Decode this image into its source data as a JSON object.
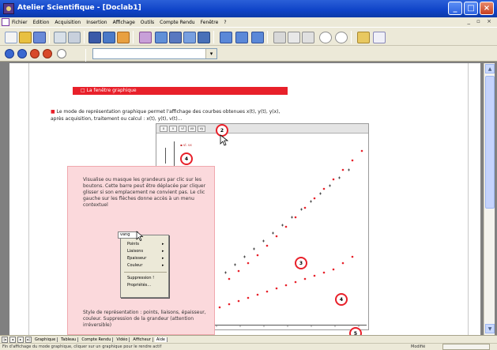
{
  "window": {
    "title": "Atelier Scientifique - [Doclab1]",
    "minimize": "_",
    "maximize": "□",
    "close": "×"
  },
  "menu": {
    "items": [
      "Fichier",
      "Edition",
      "Acquisition",
      "Insertion",
      "Affichage",
      "Outils",
      "Compte Rendu",
      "Fenêtre",
      "?"
    ],
    "mdi_controls": "_ ▫ ×"
  },
  "toolbar2": {
    "combo_value": "",
    "combo_arrow": "▾"
  },
  "document": {
    "section_title": "□ La fenêtre graphique",
    "intro_bullet": "■",
    "intro_line1": "Le mode de représentation graphique permet l'affichage des courbes obtenues x(t), y(t), y(x),",
    "intro_line2": "après acquisition, traitement ou calcul : x(t), y(t), v(t)...",
    "help_paragraph": "Visualise ou masque les grandeurs par clic sur les boutons. Cette barre peut être déplacée par cliquer glisser si son emplacement ne convient pas. Le clic gauche sur les flèches donne accès à un menu contextuel",
    "help_paragraph2": "Style de représentation : points, liaisons, épaisseur, couleur. Suppression de la grandeur (attention irréversible)",
    "context_menu": {
      "field": "vang",
      "items": [
        "Points",
        "Liaisons",
        "Epaisseur",
        "Couleur"
      ],
      "extra_items": [
        "Suppression !",
        "Propriétés..."
      ]
    },
    "badges": {
      "b2": "2",
      "b4a": "4",
      "b3": "3",
      "b4b": "4",
      "b5": "5"
    }
  },
  "graph": {
    "header_buttons": [
      "x",
      "v",
      "vl",
      "vx",
      "vy"
    ],
    "legend": "▪ vl. vx"
  },
  "tabs": {
    "nav": [
      "|◂",
      "◂",
      "▸",
      "▸|"
    ],
    "items": [
      "Graphique",
      "Tableau",
      "Compte Rendu",
      "Vidéo",
      "Afficheur",
      "Aide"
    ],
    "active_index": 5
  },
  "status": {
    "message": "Fin d'affichage du mode graphique, cliquer sur un graphique pour le rendre actif",
    "cell_label": "Modifié"
  }
}
